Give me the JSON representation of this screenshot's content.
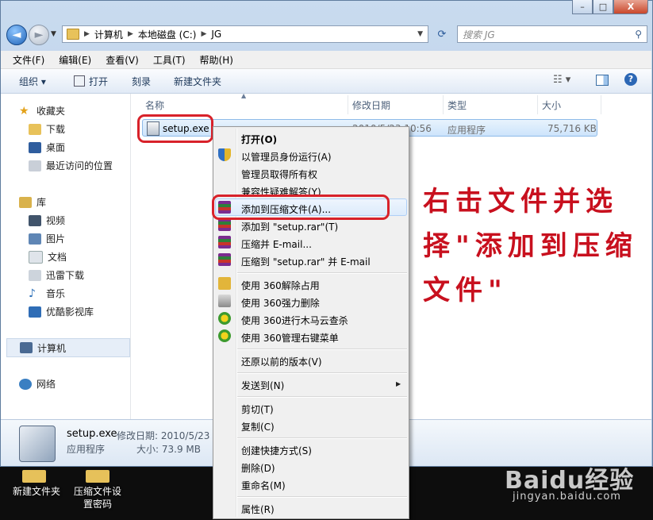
{
  "window": {
    "address_crumbs": [
      "计算机",
      "本地磁盘 (C:)",
      "JG"
    ],
    "search_placeholder": "搜索 JG",
    "caption_buttons": {
      "minimize": "–",
      "maximize": "□",
      "close": "X"
    }
  },
  "menubar": [
    "文件(F)",
    "编辑(E)",
    "查看(V)",
    "工具(T)",
    "帮助(H)"
  ],
  "toolbar": {
    "organize": "组织 ▾",
    "open": "打开",
    "burn": "刻录",
    "new_folder": "新建文件夹"
  },
  "sidebar": {
    "favorites": {
      "title": "收藏夹",
      "items": [
        "下载",
        "桌面",
        "最近访问的位置"
      ]
    },
    "libraries": {
      "title": "库",
      "items": [
        "视频",
        "图片",
        "文档",
        "迅雷下载",
        "音乐",
        "优酷影视库"
      ]
    },
    "computer": "计算机",
    "network": "网络"
  },
  "columns": [
    "名称",
    "修改日期",
    "类型",
    "大小"
  ],
  "file": {
    "name": "setup.exe",
    "date": "2010/5/23 10:56",
    "type": "应用程序",
    "size": "75,716 KB"
  },
  "details": {
    "name": "setup.exe",
    "date_label": "修改日期: 2010/5/23 1",
    "type": "应用程序",
    "size_label": "大小: 73.9 MB"
  },
  "context_menu": [
    {
      "label": "打开(O)",
      "bold": true,
      "icon": ""
    },
    {
      "label": "以管理员身份运行(A)",
      "icon": "shield-icon"
    },
    {
      "label": "管理员取得所有权",
      "icon": ""
    },
    {
      "label": "兼容性疑难解答(Y)",
      "icon": ""
    },
    {
      "label": "添加到压缩文件(A)...",
      "icon": "winrar-icon"
    },
    {
      "label": "添加到 \"setup.rar\"(T)",
      "icon": "winrar-icon"
    },
    {
      "label": "压缩并 E-mail...",
      "icon": "winrar-icon"
    },
    {
      "label": "压缩到 \"setup.rar\" 并 E-mail",
      "icon": "winrar-icon"
    },
    {
      "label": "使用 360解除占用",
      "icon": "unlock-icon"
    },
    {
      "label": "使用 360强力删除",
      "icon": "shredder-icon"
    },
    {
      "label": "使用 360进行木马云查杀",
      "icon": "360-icon"
    },
    {
      "label": "使用 360管理右键菜单",
      "icon": "360-icon"
    },
    {
      "label": "还原以前的版本(V)",
      "icon": ""
    },
    {
      "label": "发送到(N)",
      "icon": "",
      "submenu": true
    },
    {
      "label": "剪切(T)",
      "icon": ""
    },
    {
      "label": "复制(C)",
      "icon": ""
    },
    {
      "label": "创建快捷方式(S)",
      "icon": ""
    },
    {
      "label": "删除(D)",
      "icon": ""
    },
    {
      "label": "重命名(M)",
      "icon": ""
    },
    {
      "label": "属性(R)",
      "icon": ""
    }
  ],
  "annotation": "右击文件并选择\"添加到压缩文件\"",
  "desktop": {
    "icon1": "新建文件夹",
    "icon2_line1": "压缩文件设",
    "icon2_line2": "置密码"
  },
  "watermark": {
    "logo": "Baidu经验",
    "url": "jingyan.baidu.com"
  },
  "colors": {
    "annotation_red": "#c8101e",
    "highlight_box": "#d8222a",
    "selection_blue": "#cde4fb"
  }
}
